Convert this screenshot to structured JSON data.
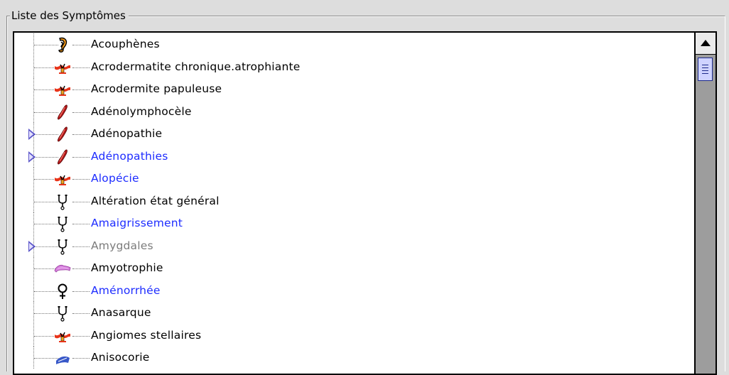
{
  "panel": {
    "title": "Liste des Symptômes"
  },
  "symptoms": [
    {
      "label": "Acouphènes",
      "icon": "ear-icon",
      "color": "black",
      "expandable": false
    },
    {
      "label": "Acrodermatite chronique.atrophiante",
      "icon": "skin-lesion-icon",
      "color": "black",
      "expandable": false
    },
    {
      "label": "Acrodermite papuleuse",
      "icon": "skin-lesion-icon",
      "color": "black",
      "expandable": false
    },
    {
      "label": "Adénolymphocèle",
      "icon": "lymph-vessel-icon",
      "color": "black",
      "expandable": false
    },
    {
      "label": "Adénopathie",
      "icon": "lymph-vessel-icon",
      "color": "black",
      "expandable": true
    },
    {
      "label": "Adénopathies",
      "icon": "lymph-vessel-icon",
      "color": "blue",
      "expandable": true
    },
    {
      "label": "Alopécie",
      "icon": "skin-lesion-icon",
      "color": "blue",
      "expandable": false
    },
    {
      "label": "Altération état général",
      "icon": "stethoscope-icon",
      "color": "black",
      "expandable": false
    },
    {
      "label": "Amaigrissement",
      "icon": "stethoscope-icon",
      "color": "blue",
      "expandable": false
    },
    {
      "label": "Amygdales",
      "icon": "stethoscope-icon",
      "color": "gray",
      "expandable": true
    },
    {
      "label": "Amyotrophie",
      "icon": "muscle-icon",
      "color": "black",
      "expandable": false
    },
    {
      "label": "Aménorrhée",
      "icon": "female-symbol-icon",
      "color": "blue",
      "expandable": false
    },
    {
      "label": "Anasarque",
      "icon": "stethoscope-icon",
      "color": "black",
      "expandable": false
    },
    {
      "label": "Angiomes stellaires",
      "icon": "skin-lesion-icon",
      "color": "black",
      "expandable": false
    },
    {
      "label": "Anisocorie",
      "icon": "eye-icon",
      "color": "black",
      "expandable": false
    }
  ],
  "colors": {
    "black": "#000000",
    "blue": "#1d2cff",
    "gray": "#7b7b7b"
  }
}
